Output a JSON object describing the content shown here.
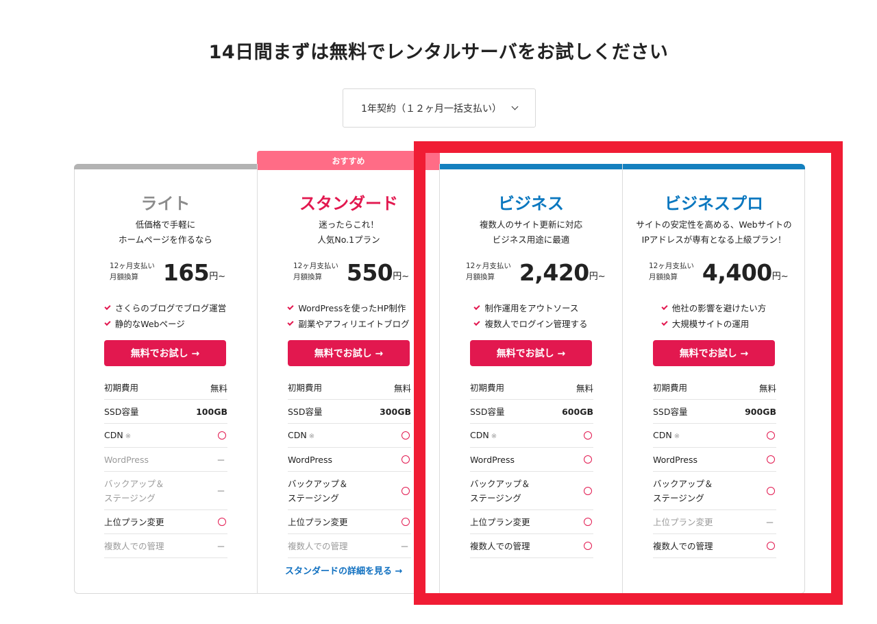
{
  "page": {
    "title": "14日間まずは無料でレンタルサーバをお試しください"
  },
  "contract": {
    "selected": "1年契約（１２ヶ月一括支払い）"
  },
  "recommend_badge": "おすすめ",
  "plans": [
    {
      "name": "ライト",
      "desc": [
        "低価格で手軽に",
        "ホームページを作るなら"
      ],
      "price_note": [
        "12ヶ月支払い",
        "月額換算"
      ],
      "price": "165",
      "price_unit": "円~",
      "features": [
        "さくらのブログでブログ運営",
        "静的なWebページ"
      ],
      "cta": "無料でお試し →",
      "specs": [
        {
          "label": "初期費用",
          "value": "無料"
        },
        {
          "label": "SSD容量",
          "value": "100GB"
        },
        {
          "label": "CDN",
          "value": "○"
        },
        {
          "label": "WordPress",
          "value": "－"
        },
        {
          "label": "バックアップ＆ ステージング",
          "value": "－"
        },
        {
          "label": "上位プラン変更",
          "value": "○"
        },
        {
          "label": "複数人での管理",
          "value": "－"
        }
      ]
    },
    {
      "name": "スタンダード",
      "desc": [
        "迷ったらこれ！",
        "人気No.1プラン"
      ],
      "price_note": [
        "12ヶ月支払い",
        "月額換算"
      ],
      "price": "550",
      "price_unit": "円~",
      "features": [
        "WordPressを使ったHP制作",
        "副業やアフィリエイトブログ"
      ],
      "cta": "無料でお試し →",
      "specs": [
        {
          "label": "初期費用",
          "value": "無料"
        },
        {
          "label": "SSD容量",
          "value": "300GB"
        },
        {
          "label": "CDN",
          "value": "○"
        },
        {
          "label": "WordPress",
          "value": "○"
        },
        {
          "label": "バックアップ＆ ステージング",
          "value": "○"
        },
        {
          "label": "上位プラン変更",
          "value": "○"
        },
        {
          "label": "複数人での管理",
          "value": "－"
        }
      ],
      "detail_link": "スタンダードの詳細を見る →"
    },
    {
      "name": "ビジネス",
      "desc": [
        "複数人のサイト更新に対応",
        "ビジネス用途に最適"
      ],
      "price_note": [
        "12ヶ月支払い",
        "月額換算"
      ],
      "price": "2,420",
      "price_unit": "円~",
      "features": [
        "制作運用をアウトソース",
        "複数人でログイン管理する"
      ],
      "cta": "無料でお試し →",
      "specs": [
        {
          "label": "初期費用",
          "value": "無料"
        },
        {
          "label": "SSD容量",
          "value": "600GB"
        },
        {
          "label": "CDN",
          "value": "○"
        },
        {
          "label": "WordPress",
          "value": "○"
        },
        {
          "label": "バックアップ＆ ステージング",
          "value": "○"
        },
        {
          "label": "上位プラン変更",
          "value": "○"
        },
        {
          "label": "複数人での管理",
          "value": "○"
        }
      ]
    },
    {
      "name": "ビジネスプロ",
      "desc": [
        "サイトの安定性を高める、Webサイトの",
        "IPアドレスが専有となる上級プラン！"
      ],
      "price_note": [
        "12ヶ月支払い",
        "月額換算"
      ],
      "price": "4,400",
      "price_unit": "円~",
      "features": [
        "他社の影響を避けたい方",
        "大規模サイトの運用"
      ],
      "cta": "無料でお試し →",
      "specs": [
        {
          "label": "初期費用",
          "value": "無料"
        },
        {
          "label": "SSD容量",
          "value": "900GB"
        },
        {
          "label": "CDN",
          "value": "○"
        },
        {
          "label": "WordPress",
          "value": "○"
        },
        {
          "label": "バックアップ＆ ステージング",
          "value": "○"
        },
        {
          "label": "上位プラン変更",
          "value": "－"
        },
        {
          "label": "複数人での管理",
          "value": "○"
        }
      ]
    }
  ],
  "cdn_mark": "※",
  "colors": {
    "brand_red": "#e2184f",
    "business_blue": "#1480bf",
    "recommend_pink": "#ff6c86",
    "highlight_red": "#f01c34"
  }
}
